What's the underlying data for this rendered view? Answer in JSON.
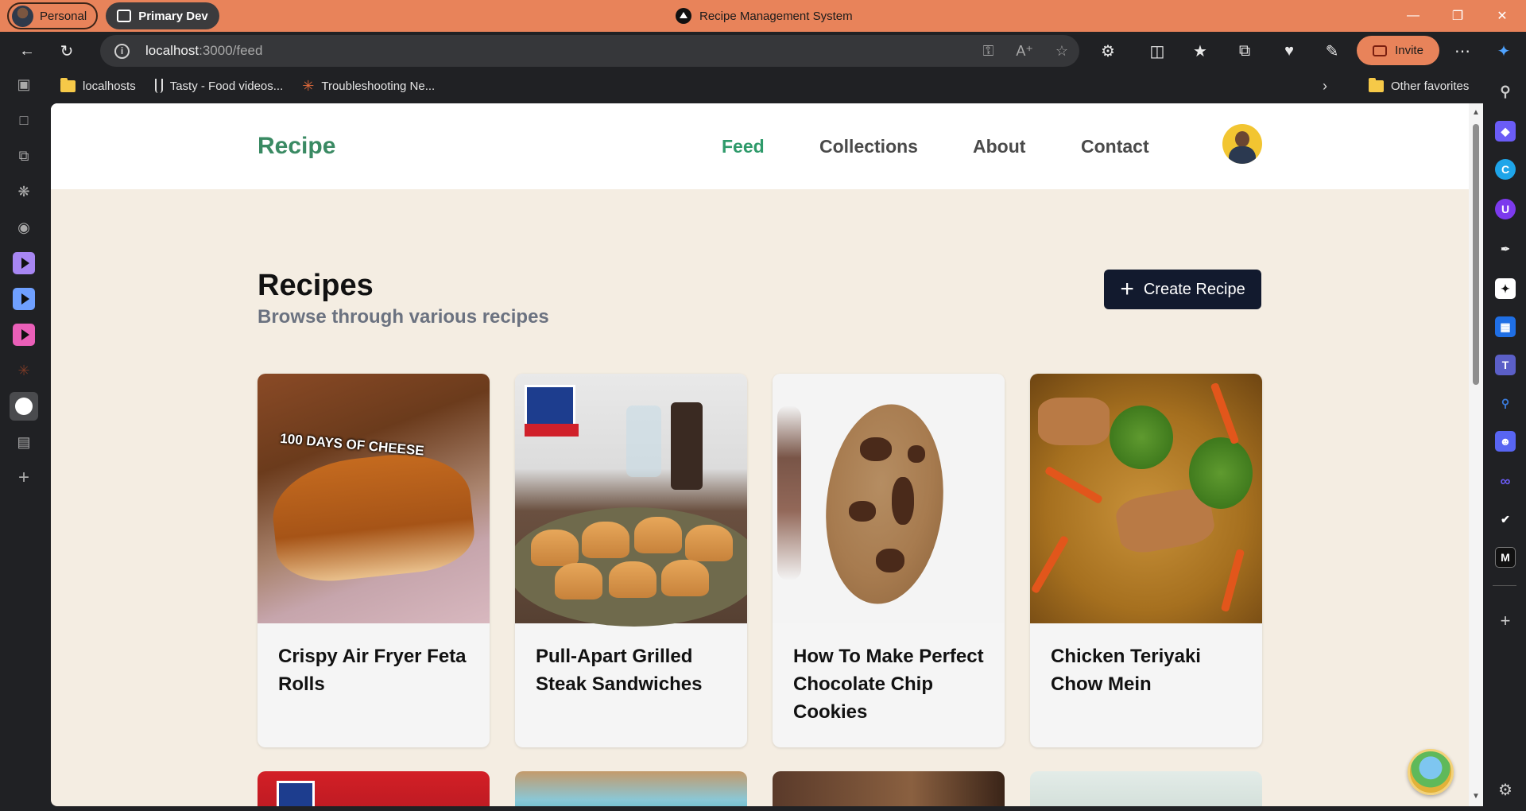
{
  "browser": {
    "profile_label": "Personal",
    "workspace_label": "Primary Dev",
    "window_title": "Recipe Management System",
    "address": {
      "host": "localhost",
      "path": ":3000/feed"
    },
    "invite_label": "Invite",
    "favorites": [
      {
        "label": "localhosts",
        "icon": "folder-icon"
      },
      {
        "label": "Tasty - Food videos...",
        "icon": "fork-icon"
      },
      {
        "label": "Troubleshooting Ne...",
        "icon": "claude-star-icon"
      }
    ],
    "other_favorites_label": "Other favorites"
  },
  "site": {
    "logo": "Recipe",
    "nav": [
      {
        "label": "Feed",
        "active": true
      },
      {
        "label": "Collections",
        "active": false
      },
      {
        "label": "About",
        "active": false
      },
      {
        "label": "Contact",
        "active": false
      }
    ],
    "page_title": "Recipes",
    "page_subtitle": "Browse through various recipes",
    "create_button_label": "Create Recipe"
  },
  "recipes": [
    {
      "title": "Crispy Air Fryer Feta Rolls",
      "image_caption": "100 DAYS OF CHEESE"
    },
    {
      "title": "Pull-Apart Grilled Steak Sandwiches",
      "image_caption": "McCormick"
    },
    {
      "title": "How To Make Perfect Chocolate Chip Cookies"
    },
    {
      "title": "Chicken Teriyaki Chow Mein"
    }
  ],
  "colors": {
    "titlebar": "#e8835a",
    "brand_green": "#3a8a63",
    "nav_active": "#2e9a6a",
    "page_bg": "#f4ede2",
    "create_button_bg": "#121a2e"
  }
}
